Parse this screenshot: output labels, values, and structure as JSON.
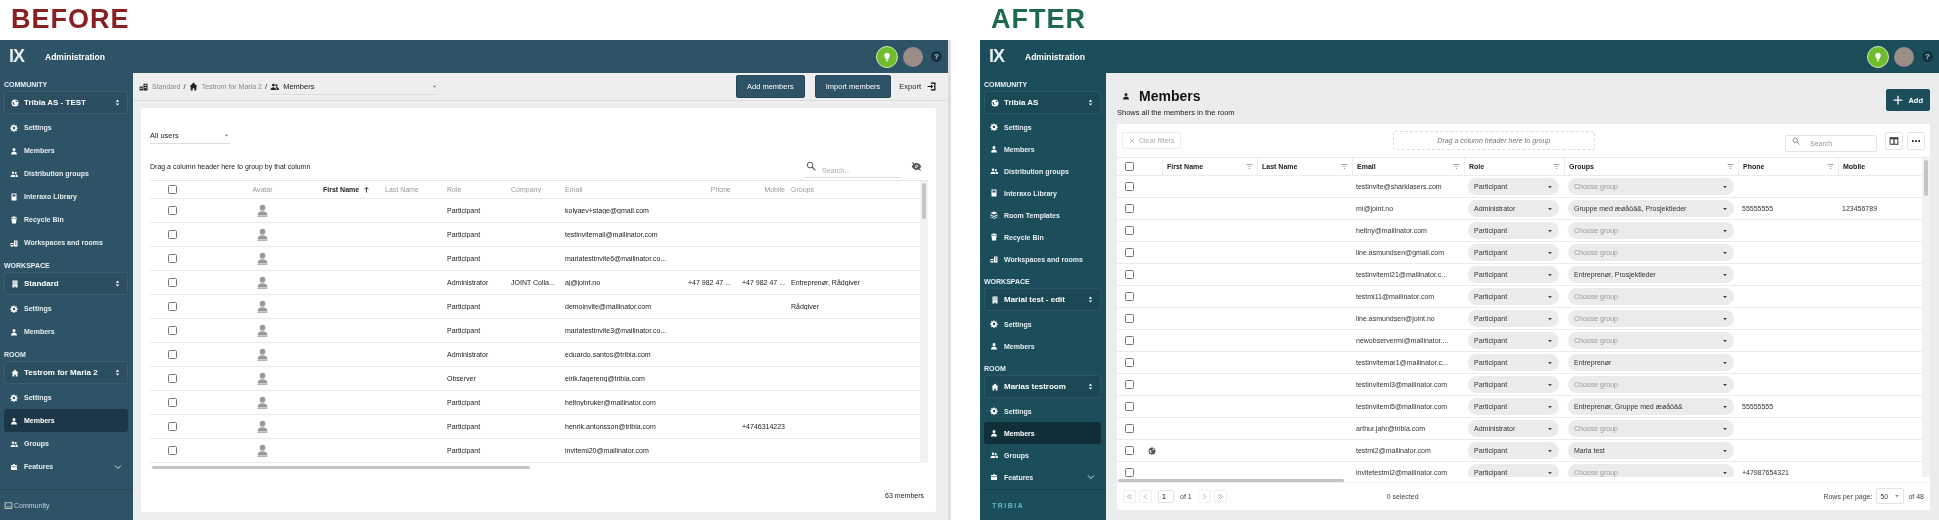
{
  "before": {
    "label": "BEFORE",
    "header": {
      "logo": "lX",
      "title": "Administration",
      "help": "?"
    },
    "sidebar": {
      "sections": [
        {
          "heading": "COMMUNITY",
          "selector": {
            "kind": "globe",
            "label": "Tribia AS - TEST"
          },
          "items": [
            {
              "kind": "settings",
              "label": "Settings",
              "selected": false
            },
            {
              "kind": "person",
              "label": "Members",
              "selected": false
            },
            {
              "kind": "people",
              "label": "Distribution groups",
              "selected": false
            },
            {
              "kind": "book",
              "label": "Interaxo Library",
              "selected": false
            },
            {
              "kind": "trash",
              "label": "Recycle Bin",
              "selected": false
            },
            {
              "kind": "buildings",
              "label": "Workspaces and rooms",
              "selected": false
            }
          ]
        },
        {
          "heading": "WORKSPACE",
          "selector": {
            "kind": "building",
            "label": "Standard"
          },
          "items": [
            {
              "kind": "settings",
              "label": "Settings",
              "selected": false
            },
            {
              "kind": "person",
              "label": "Members",
              "selected": false
            }
          ]
        },
        {
          "heading": "ROOM",
          "selector": {
            "kind": "home",
            "label": "Testrom for Maria 2"
          },
          "items": [
            {
              "kind": "settings",
              "label": "Settings",
              "selected": false
            },
            {
              "kind": "person",
              "label": "Members",
              "selected": true
            },
            {
              "kind": "people",
              "label": "Groups",
              "selected": false
            },
            {
              "kind": "toolbox",
              "label": "Features",
              "selected": false,
              "expanded": false
            }
          ]
        }
      ],
      "footer": {
        "kind": "broken-image",
        "label": "Community"
      }
    },
    "breadcrumb": {
      "path": [
        {
          "kind": "buildings",
          "label": "Standard"
        },
        {
          "kind": "home",
          "label": "Testrom for Maria 2"
        }
      ],
      "separator": "/",
      "current": {
        "kind": "people",
        "label": "Members"
      }
    },
    "actions": [
      {
        "kind": "primary",
        "label": "Add members"
      },
      {
        "kind": "primary",
        "label": "Import members"
      },
      {
        "kind": "export",
        "label": "Export"
      }
    ],
    "filter": {
      "value": "All users"
    },
    "group_hint": "Drag a column header here to group by that column",
    "search": {
      "placeholder": "Search..."
    },
    "table": {
      "header_checked": false,
      "columns": [
        {
          "label": "Avatar",
          "sorted": false
        },
        {
          "label": "First Name",
          "sorted": true
        },
        {
          "label": "Last Name",
          "sorted": false
        },
        {
          "label": "Role",
          "sorted": false
        },
        {
          "label": "Company",
          "sorted": false
        },
        {
          "label": "Email",
          "sorted": false
        },
        {
          "label": "Phone",
          "sorted": false
        },
        {
          "label": "Mobile",
          "sorted": false
        },
        {
          "label": "Groups",
          "sorted": false
        }
      ],
      "rows": [
        {
          "checked": false,
          "role": "Participant",
          "email": "kolyaev+stage@gmail.com"
        },
        {
          "checked": false,
          "role": "Participant",
          "email": "testinvitemail@mailinator.com"
        },
        {
          "checked": false,
          "role": "Participant",
          "email": "mariatestinvite6@mailinator.co..."
        },
        {
          "checked": false,
          "role": "Administrator",
          "company": "JOINT Colla...",
          "email": "aj@joint.no",
          "phone": "+47 982 47 ...",
          "mobile": "+47 982 47 ...",
          "groups": "Entreprenør, Rådgiver"
        },
        {
          "checked": false,
          "role": "Participant",
          "email": "demoinvite@mailinator.com",
          "groups": "Rådgiver"
        },
        {
          "checked": false,
          "role": "Participant",
          "email": "mariatestinvite3@mailinator.co..."
        },
        {
          "checked": false,
          "role": "Administrator",
          "email": "eduardo.santos@tribia.com"
        },
        {
          "checked": false,
          "role": "Observer",
          "email": "eirik.fagereng@tribia.com"
        },
        {
          "checked": false,
          "role": "Participant",
          "email": "heltnybruker@mailinator.com"
        },
        {
          "checked": false,
          "role": "Participant",
          "email": "henrik.antonsson@tribia.com",
          "mobile": "+4746314223"
        },
        {
          "checked": false,
          "role": "Participant",
          "email": "invitemi20@mailinator.com"
        }
      ]
    },
    "count": "63 members"
  },
  "after": {
    "label": "AFTER",
    "header": {
      "logo": "lX",
      "title": "Administration",
      "help": "?"
    },
    "sidebar": {
      "sections": [
        {
          "heading": "COMMUNITY",
          "selector": {
            "kind": "globe",
            "label": "Tribia AS"
          },
          "items": [
            {
              "kind": "settings",
              "label": "Settings",
              "selected": false
            },
            {
              "kind": "person",
              "label": "Members",
              "selected": false
            },
            {
              "kind": "people",
              "label": "Distribution groups",
              "selected": false
            },
            {
              "kind": "book",
              "label": "Interaxo Library",
              "selected": false
            },
            {
              "kind": "templates",
              "label": "Room Templates",
              "selected": false
            },
            {
              "kind": "trash",
              "label": "Recycle Bin",
              "selected": false
            },
            {
              "kind": "buildings",
              "label": "Workspaces and rooms",
              "selected": false
            }
          ]
        },
        {
          "heading": "WORKSPACE",
          "selector": {
            "kind": "building",
            "label": "Marial test - edit"
          },
          "items": [
            {
              "kind": "settings",
              "label": "Settings",
              "selected": false
            },
            {
              "kind": "person",
              "label": "Members",
              "selected": false
            }
          ]
        },
        {
          "heading": "ROOM",
          "selector": {
            "kind": "home",
            "label": "Marias testroom"
          },
          "items": [
            {
              "kind": "settings",
              "label": "Settings",
              "selected": false
            },
            {
              "kind": "person",
              "label": "Members",
              "selected": true
            },
            {
              "kind": "people",
              "label": "Groups",
              "selected": false
            },
            {
              "kind": "toolbox",
              "label": "Features",
              "selected": false,
              "expanded": false
            }
          ]
        }
      ],
      "footer": {
        "kind": "logo",
        "label": "TRIBIA"
      }
    },
    "page": {
      "title": "Members",
      "subtitle": "Shows all the members in the room",
      "add": "Add"
    },
    "toolbar": {
      "clear": {
        "label": "Clear filters",
        "disabled": true
      },
      "group_hint": "Drag a column header here to group",
      "search": {
        "placeholder": "Search"
      }
    },
    "table": {
      "header_checked": false,
      "columns": [
        {
          "label": "First Name"
        },
        {
          "label": "Last Name"
        },
        {
          "label": "Email"
        },
        {
          "label": "Role"
        },
        {
          "label": "Groups"
        },
        {
          "label": "Phone"
        },
        {
          "label": "Mobile"
        }
      ],
      "rows": [
        {
          "checked": false,
          "external": false,
          "email": "testinvite@sharklasers.com",
          "role": "Participant",
          "groups": {
            "placeholder": "Choose group"
          }
        },
        {
          "checked": false,
          "external": false,
          "email": "mi@joint.no",
          "role": "Administrator",
          "groups": {
            "value": "Gruppe med æøåöä&, Prosjektleder"
          },
          "phone": "55555555",
          "mobile": "123456789"
        },
        {
          "checked": false,
          "external": false,
          "email": "heltny@mailinator.com",
          "role": "Participant",
          "groups": {
            "placeholder": "Choose group"
          }
        },
        {
          "checked": false,
          "external": false,
          "email": "line.asmundsen@gmail.com",
          "role": "Participant",
          "groups": {
            "placeholder": "Choose group"
          }
        },
        {
          "checked": false,
          "external": false,
          "email": "testinvitemi21@mailinator.c...",
          "role": "Participant",
          "groups": {
            "value": "Entreprenør, Prosjektleder"
          }
        },
        {
          "checked": false,
          "external": false,
          "email": "testmi11@mailinator.com",
          "role": "Participant",
          "groups": {
            "placeholder": "Choose group"
          }
        },
        {
          "checked": false,
          "external": false,
          "email": "line.asmundsen@joint.no",
          "role": "Participant",
          "groups": {
            "placeholder": "Choose group"
          }
        },
        {
          "checked": false,
          "external": false,
          "email": "newobservermi@mailinator....",
          "role": "Participant",
          "groups": {
            "placeholder": "Choose group"
          }
        },
        {
          "checked": false,
          "external": false,
          "email": "testinvitemar1@mailinator.c...",
          "role": "Participant",
          "groups": {
            "value": "Entreprenør"
          }
        },
        {
          "checked": false,
          "external": false,
          "email": "testinvitemi3@mailinator.com",
          "role": "Participant",
          "groups": {
            "placeholder": "Choose group"
          }
        },
        {
          "checked": false,
          "external": false,
          "email": "testinvitemi5@mailinator.com",
          "role": "Participant",
          "groups": {
            "value": "Entreprenør, Gruppe med æøåöä&"
          },
          "phone": "55555555"
        },
        {
          "checked": false,
          "external": false,
          "email": "arthur.jahr@tribia.com",
          "role": "Administrator",
          "groups": {
            "placeholder": "Choose group"
          }
        },
        {
          "checked": false,
          "external": true,
          "email": "testmi2@mailinator.com",
          "role": "Participant",
          "groups": {
            "value": "Maria test"
          }
        },
        {
          "checked": false,
          "external": false,
          "email": "invitetestmi2@mailinator.com",
          "role": "Participant",
          "groups": {
            "placeholder": "Choose group"
          },
          "phone": "+47987654321"
        }
      ]
    },
    "footer": {
      "page": "1",
      "page_count": "of 1",
      "selected": "0 selected",
      "rows_label": "Rows per page:",
      "rows_value": "50",
      "total": "of 48"
    }
  }
}
